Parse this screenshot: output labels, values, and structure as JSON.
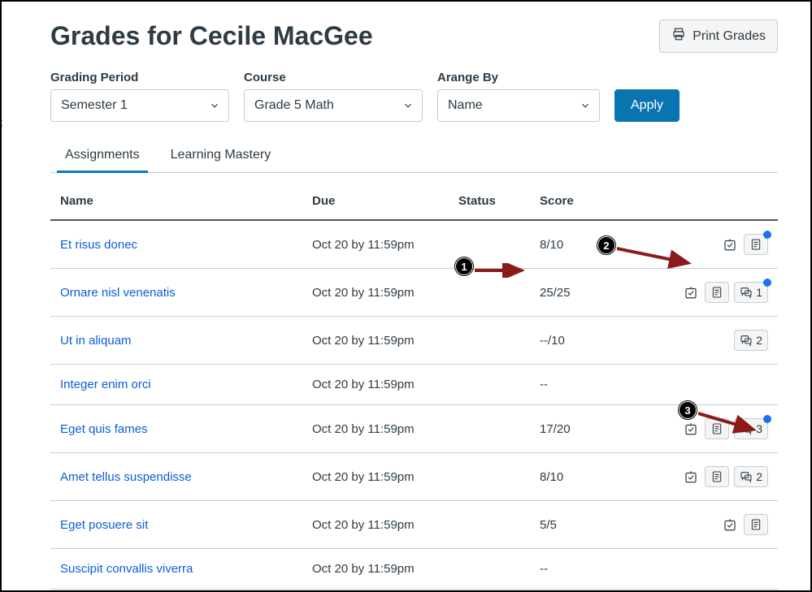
{
  "header": {
    "title": "Grades for Cecile MacGee",
    "print_label": "Print Grades"
  },
  "filters": {
    "grading_period": {
      "label": "Grading Period",
      "value": "Semester 1"
    },
    "course": {
      "label": "Course",
      "value": "Grade 5 Math"
    },
    "arrange_by": {
      "label": "Arange By",
      "value": "Name"
    },
    "apply_label": "Apply"
  },
  "tabs": {
    "assignments": "Assignments",
    "learning_mastery": "Learning Mastery",
    "active": "assignments"
  },
  "columns": {
    "name": "Name",
    "due": "Due",
    "status": "Status",
    "score": "Score"
  },
  "rows": [
    {
      "name": "Et risus donec",
      "due": "Oct 20 by 11:59pm",
      "status": "",
      "score": "8/10",
      "check": true,
      "rubric": true,
      "rubric_dot": true,
      "has_comments": false,
      "comments": "",
      "comments_dot": false
    },
    {
      "name": "Ornare nisl venenatis",
      "due": "Oct 20 by 11:59pm",
      "status": "",
      "score": "25/25",
      "check": true,
      "rubric": true,
      "rubric_dot": false,
      "has_comments": true,
      "comments": "1",
      "comments_dot": true
    },
    {
      "name": "Ut in aliquam",
      "due": "Oct 20 by 11:59pm",
      "status": "",
      "score": "--/10",
      "check": false,
      "rubric": false,
      "rubric_dot": false,
      "has_comments": true,
      "comments": "2",
      "comments_dot": false
    },
    {
      "name": "Integer enim orci",
      "due": "Oct 20 by 11:59pm",
      "status": "",
      "score": "--",
      "check": false,
      "rubric": false,
      "rubric_dot": false,
      "has_comments": false,
      "comments": "",
      "comments_dot": false
    },
    {
      "name": "Eget quis fames",
      "due": "Oct 20 by 11:59pm",
      "status": "",
      "score": "17/20",
      "check": true,
      "rubric": true,
      "rubric_dot": false,
      "has_comments": true,
      "comments": "3",
      "comments_dot": true
    },
    {
      "name": "Amet tellus suspendisse",
      "due": "Oct 20 by 11:59pm",
      "status": "",
      "score": "8/10",
      "check": true,
      "rubric": true,
      "rubric_dot": false,
      "has_comments": true,
      "comments": "2",
      "comments_dot": false
    },
    {
      "name": "Eget posuere sit",
      "due": "Oct 20 by 11:59pm",
      "status": "",
      "score": "5/5",
      "check": true,
      "rubric": true,
      "rubric_dot": false,
      "has_comments": false,
      "comments": "",
      "comments_dot": false
    },
    {
      "name": "Suscipit convallis viverra",
      "due": "Oct 20 by 11:59pm",
      "status": "",
      "score": "--",
      "check": false,
      "rubric": false,
      "rubric_dot": false,
      "has_comments": false,
      "comments": "",
      "comments_dot": false
    }
  ],
  "annotations": {
    "one": "1",
    "two": "2",
    "three": "3"
  },
  "stray": ";"
}
